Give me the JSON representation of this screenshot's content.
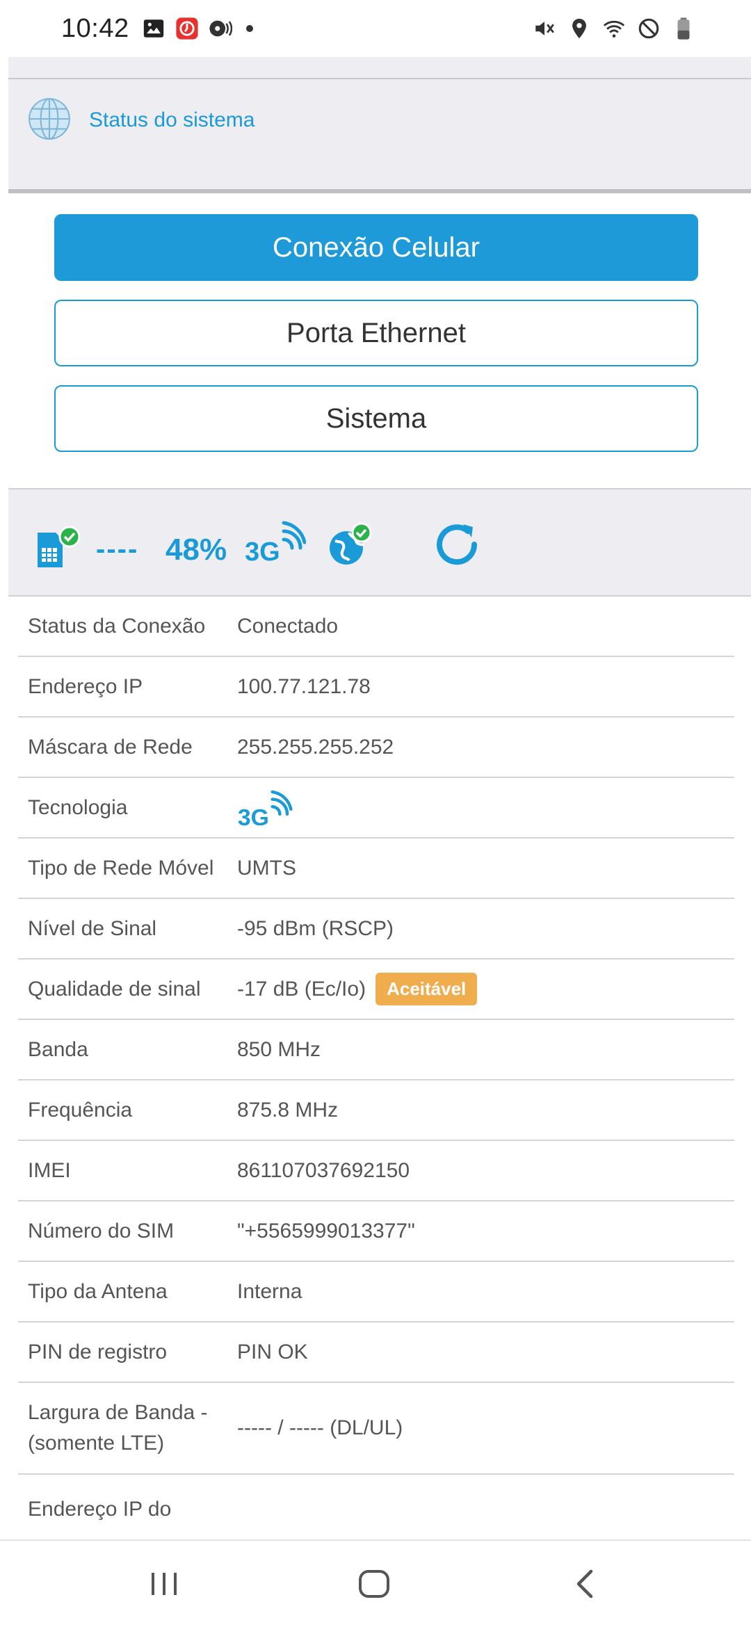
{
  "status_bar": {
    "time": "10:42",
    "left_icons": [
      "gallery-icon",
      "app-red-icon",
      "podcast-icon",
      "notification-dot"
    ],
    "right_icons": [
      "vibrate-mute-icon",
      "location-icon",
      "wifi-icon",
      "do-not-disturb-icon",
      "battery-icon"
    ]
  },
  "header": {
    "title": "Status do sistema",
    "accent_color": "#1a9ad6"
  },
  "menu": {
    "items": [
      {
        "label": "Conexão Celular",
        "active": true
      },
      {
        "label": "Porta Ethernet",
        "active": false
      },
      {
        "label": "Sistema",
        "active": false
      }
    ]
  },
  "icon_strip": {
    "dashes": "----",
    "signal_percent": "48%",
    "icons": [
      "sim-check-icon",
      "network-3g-icon",
      "globe-check-icon",
      "refresh-icon"
    ]
  },
  "table": {
    "rows": [
      {
        "label": "Status da Conexão",
        "value": "Conectado"
      },
      {
        "label": "Endereço IP",
        "value": "100.77.121.78"
      },
      {
        "label": "Máscara de Rede",
        "value": "255.255.255.252"
      },
      {
        "label": "Tecnologia",
        "value": "",
        "icon": "network-3g-icon"
      },
      {
        "label": "Tipo de Rede Móvel",
        "value": "UMTS"
      },
      {
        "label": "Nível de Sinal",
        "value": "-95 dBm (RSCP)"
      },
      {
        "label": "Qualidade de sinal",
        "value": "-17 dB (Ec/Io)",
        "badge": "Aceitável",
        "badge_color": "#f0ad4e"
      },
      {
        "label": "Banda",
        "value": "850 MHz"
      },
      {
        "label": "Frequência",
        "value": "875.8 MHz"
      },
      {
        "label": "IMEI",
        "value": "861107037692150"
      },
      {
        "label": "Número do SIM",
        "value": "\"+5565999013377\""
      },
      {
        "label": "Tipo da Antena",
        "value": "Interna"
      },
      {
        "label": "PIN de registro",
        "value": "PIN OK"
      },
      {
        "label_line1": "Largura de Banda -",
        "label_line2": "(somente LTE)",
        "value": "----- / ----- (DL/UL)"
      },
      {
        "label": "Endereço IP do",
        "value": ""
      }
    ]
  },
  "nav_bar": {
    "buttons": [
      "recents-icon",
      "home-icon",
      "back-icon"
    ]
  }
}
